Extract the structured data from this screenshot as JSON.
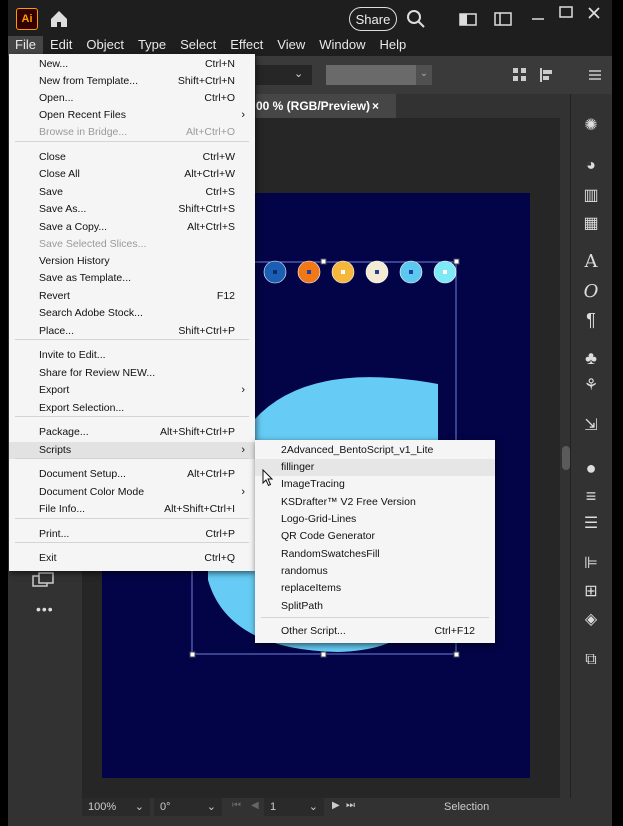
{
  "app": {
    "logo": "Ai"
  },
  "titlebar": {
    "share_label": "Share"
  },
  "menubar": [
    "File",
    "Edit",
    "Object",
    "Type",
    "Select",
    "Effect",
    "View",
    "Window",
    "Help"
  ],
  "document_tab": {
    "title": "00 % (RGB/Preview)",
    "close": "×"
  },
  "file_menu": [
    {
      "label": "New...",
      "shortcut": "Ctrl+N",
      "disabled": false,
      "submenu": false
    },
    {
      "label": "New from Template...",
      "shortcut": "Shift+Ctrl+N",
      "disabled": false,
      "submenu": false
    },
    {
      "label": "Open...",
      "shortcut": "Ctrl+O",
      "disabled": false,
      "submenu": false
    },
    {
      "label": "Open Recent Files",
      "shortcut": "",
      "disabled": false,
      "submenu": true
    },
    {
      "label": "Browse in Bridge...",
      "shortcut": "Alt+Ctrl+O",
      "disabled": true,
      "submenu": false
    },
    {
      "label": "Close",
      "shortcut": "Ctrl+W",
      "disabled": false,
      "submenu": false
    },
    {
      "label": "Close All",
      "shortcut": "Alt+Ctrl+W",
      "disabled": false,
      "submenu": false
    },
    {
      "label": "Save",
      "shortcut": "Ctrl+S",
      "disabled": false,
      "submenu": false
    },
    {
      "label": "Save As...",
      "shortcut": "Shift+Ctrl+S",
      "disabled": false,
      "submenu": false
    },
    {
      "label": "Save a Copy...",
      "shortcut": "Alt+Ctrl+S",
      "disabled": false,
      "submenu": false
    },
    {
      "label": "Save Selected Slices...",
      "shortcut": "",
      "disabled": true,
      "submenu": false
    },
    {
      "label": "Version History",
      "shortcut": "",
      "disabled": false,
      "submenu": false
    },
    {
      "label": "Save as Template...",
      "shortcut": "",
      "disabled": false,
      "submenu": false
    },
    {
      "label": "Revert",
      "shortcut": "F12",
      "disabled": false,
      "submenu": false
    },
    {
      "label": "Search Adobe Stock...",
      "shortcut": "",
      "disabled": false,
      "submenu": false
    },
    {
      "label": "Place...",
      "shortcut": "Shift+Ctrl+P",
      "disabled": false,
      "submenu": false
    },
    {
      "label": "Invite to Edit...",
      "shortcut": "",
      "disabled": false,
      "submenu": false
    },
    {
      "label": "Share for Review NEW...",
      "shortcut": "",
      "disabled": false,
      "submenu": false
    },
    {
      "label": "Export",
      "shortcut": "",
      "disabled": false,
      "submenu": true
    },
    {
      "label": "Export Selection...",
      "shortcut": "",
      "disabled": false,
      "submenu": false
    },
    {
      "label": "Package...",
      "shortcut": "Alt+Shift+Ctrl+P",
      "disabled": false,
      "submenu": false
    },
    {
      "label": "Scripts",
      "shortcut": "",
      "disabled": false,
      "submenu": true,
      "highlighted": true
    },
    {
      "label": "Document Setup...",
      "shortcut": "Alt+Ctrl+P",
      "disabled": false,
      "submenu": false
    },
    {
      "label": "Document Color Mode",
      "shortcut": "",
      "disabled": false,
      "submenu": true
    },
    {
      "label": "File Info...",
      "shortcut": "Alt+Shift+Ctrl+I",
      "disabled": false,
      "submenu": false
    },
    {
      "label": "Print...",
      "shortcut": "Ctrl+P",
      "disabled": false,
      "submenu": false
    },
    {
      "label": "Exit",
      "shortcut": "Ctrl+Q",
      "disabled": false,
      "submenu": false
    }
  ],
  "scripts_menu": [
    {
      "label": "2Advanced_BentoScript_v1_Lite",
      "shortcut": ""
    },
    {
      "label": "fillinger",
      "shortcut": "",
      "highlighted": true
    },
    {
      "label": "ImageTracing",
      "shortcut": ""
    },
    {
      "label": "KSDrafter™ V2 Free Version",
      "shortcut": ""
    },
    {
      "label": "Logo-Grid-Lines",
      "shortcut": ""
    },
    {
      "label": "QR Code Generator",
      "shortcut": ""
    },
    {
      "label": "RandomSwatchesFill",
      "shortcut": ""
    },
    {
      "label": "randomus",
      "shortcut": ""
    },
    {
      "label": "replaceItems",
      "shortcut": ""
    },
    {
      "label": "SplitPath",
      "shortcut": ""
    },
    {
      "label": "Other Script...",
      "shortcut": "Ctrl+F12"
    }
  ],
  "statusbar": {
    "zoom": "100%",
    "rotation": "0°",
    "artboard": "1",
    "tool": "Selection"
  },
  "colors": {
    "artboard": "#030447",
    "shape": "#66ccf5",
    "dots": [
      "#1a5fb4",
      "#f07818",
      "#f6b73c",
      "#f4ecd2",
      "#5cc8f0",
      "#7ee8f4"
    ]
  }
}
